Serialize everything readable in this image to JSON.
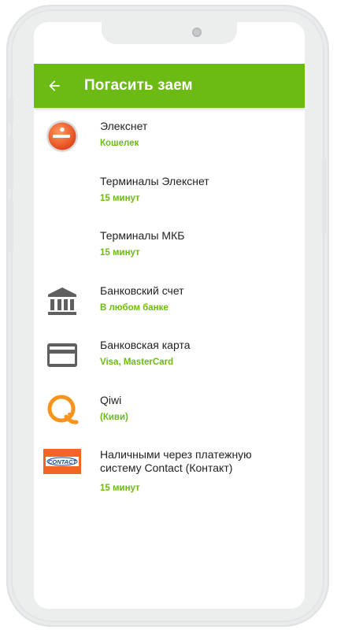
{
  "header": {
    "title": "Погасить заем",
    "back_icon": "arrow-back-icon"
  },
  "colors": {
    "accent": "#6cbb14",
    "text": "#222222",
    "icon_gray": "#5f5f5f",
    "qiwi_orange": "#f7941d",
    "eleksnet_orange": "#f15a22",
    "contact_orange": "#f26522"
  },
  "methods": [
    {
      "title": "Элекснет",
      "subtitle": "Кошелек",
      "icon": "eleksnet-logo"
    },
    {
      "title": "Терминалы Элекснет",
      "subtitle": "15 минут",
      "icon": ""
    },
    {
      "title": "Терминалы МКБ",
      "subtitle": "15 минут",
      "icon": ""
    },
    {
      "title": "Банковский счет",
      "subtitle": "В любом банке",
      "icon": "bank-icon"
    },
    {
      "title": "Банковская карта",
      "subtitle": "Visa, MasterCard",
      "icon": "credit-card-icon"
    },
    {
      "title": "Qiwi",
      "subtitle": "(Киви)",
      "icon": "qiwi-logo"
    },
    {
      "title": "Наличными через платежную систему Contact (Контакт)",
      "subtitle": "15 минут",
      "icon": "contact-logo",
      "logo_text": "CONTACT"
    }
  ]
}
